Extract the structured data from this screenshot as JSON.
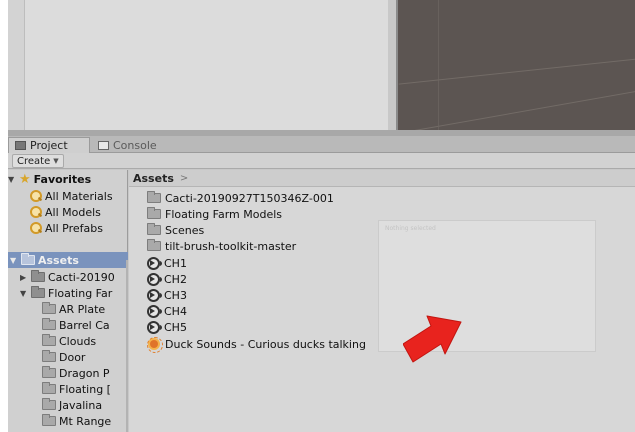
{
  "tabs": {
    "project": "Project",
    "console": "Console"
  },
  "toolbar": {
    "create_label": "Create"
  },
  "favorites": {
    "header": "Favorites",
    "items": [
      "All Materials",
      "All Models",
      "All Prefabs"
    ]
  },
  "assets_tree": {
    "header": "Assets",
    "items": [
      {
        "label": "Cacti-20190",
        "level": 1,
        "expanded": false
      },
      {
        "label": "Floating Far",
        "level": 1,
        "expanded": true
      },
      {
        "label": "AR Plate",
        "level": 2
      },
      {
        "label": "Barrel Ca",
        "level": 2
      },
      {
        "label": "Clouds",
        "level": 2
      },
      {
        "label": "Door",
        "level": 2
      },
      {
        "label": "Dragon P",
        "level": 2
      },
      {
        "label": "Floating [",
        "level": 2
      },
      {
        "label": "Javalina",
        "level": 2
      },
      {
        "label": "Mt Range",
        "level": 2
      }
    ]
  },
  "main": {
    "breadcrumb": "Assets",
    "breadcrumb_sep": ">",
    "items": [
      {
        "label": "Cacti-20190927T150346Z-001",
        "type": "folder"
      },
      {
        "label": "Floating Farm Models",
        "type": "folder"
      },
      {
        "label": "Scenes",
        "type": "folder"
      },
      {
        "label": "tilt-brush-toolkit-master",
        "type": "folder"
      },
      {
        "label": "CH1",
        "type": "audio"
      },
      {
        "label": "CH2",
        "type": "audio"
      },
      {
        "label": "CH3",
        "type": "audio"
      },
      {
        "label": "CH4",
        "type": "audio"
      },
      {
        "label": "CH5",
        "type": "audio"
      },
      {
        "label": "Duck Sounds - Curious ducks talking",
        "type": "audio-source"
      }
    ],
    "preview_label": "Nothing selected"
  },
  "colors": {
    "assets_header_bg": "#7a93bd",
    "arrow": "#e8231e",
    "scene_bg": "#5c5552"
  },
  "icons": {
    "project_tab": "folder-icon",
    "console_tab": "console-icon",
    "favorites": "star-icon",
    "favorite_item": "search-icon",
    "folder": "folder-icon",
    "audio": "audio-clip-icon",
    "audio_source": "audio-source-icon",
    "annotation": "red-arrow"
  }
}
